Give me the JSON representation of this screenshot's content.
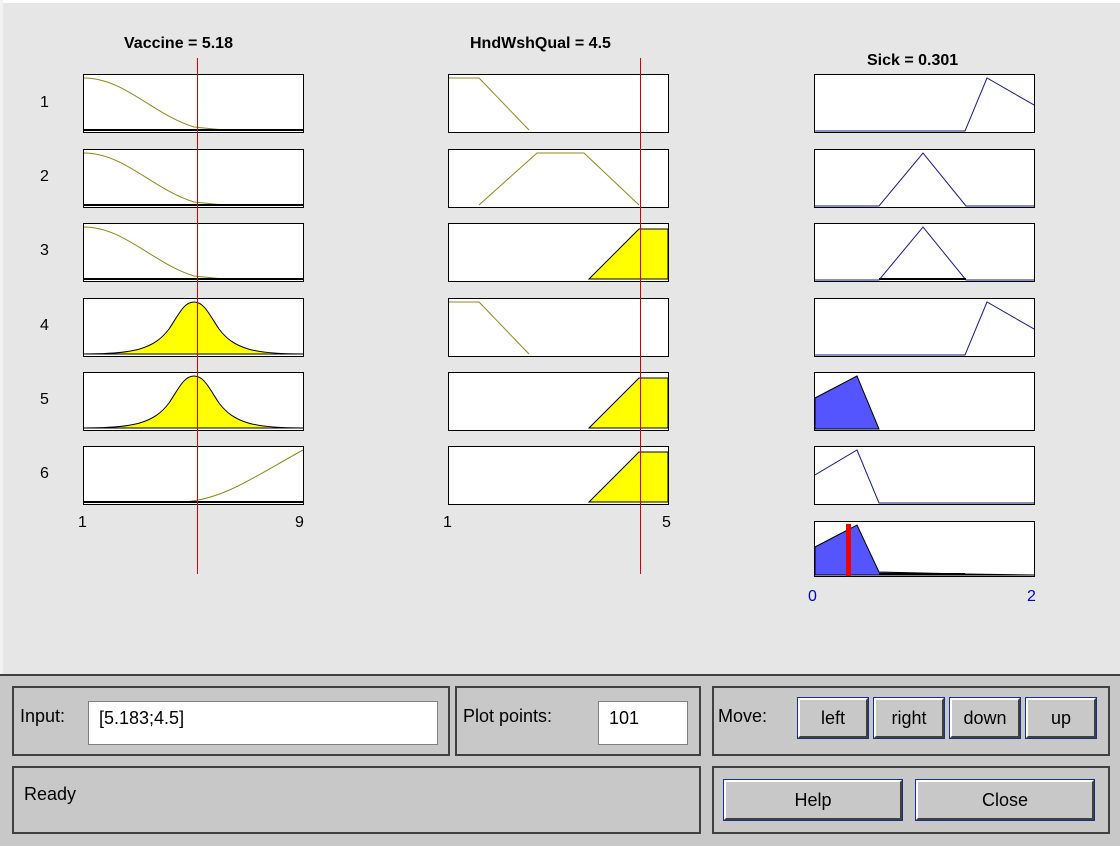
{
  "columns": {
    "vaccine": {
      "title": "Vaccine = 5.18",
      "range_min": "1",
      "range_max": "9",
      "value": 5.18
    },
    "hndwshqual": {
      "title": "HndWshQual = 4.5",
      "range_min": "1",
      "range_max": "5",
      "value": 4.5
    },
    "sick": {
      "title": "Sick = 0.301",
      "range_min": "0",
      "range_max": "2",
      "value": 0.301
    }
  },
  "rules": [
    "1",
    "2",
    "3",
    "4",
    "5",
    "6"
  ],
  "colors": {
    "input_fill": "#ffff00",
    "input_line": "#8a8a1a",
    "output_fill": "#5555ff",
    "output_line": "#1a1a8a",
    "marker": "#cc0000",
    "axis_output": "#0000cc"
  },
  "controls": {
    "input_label": "Input:",
    "input_value": "[5.183;4.5]",
    "plot_points_label": "Plot points:",
    "plot_points_value": "101",
    "move_label": "Move:",
    "move_left": "left",
    "move_right": "right",
    "move_down": "down",
    "move_up": "up",
    "status": "Ready",
    "help": "Help",
    "close": "Close"
  }
}
